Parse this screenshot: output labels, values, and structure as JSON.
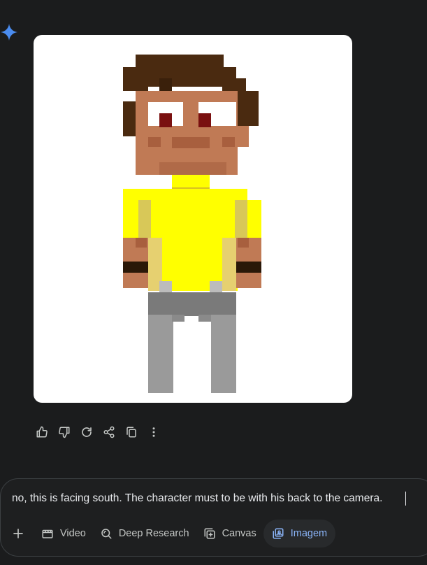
{
  "response": {
    "image_alt": "Pixel-art character with brown hair wearing a yellow t-shirt and gray pants, facing the camera",
    "actions": [
      {
        "name": "thumbs-up-icon"
      },
      {
        "name": "thumbs-down-icon"
      },
      {
        "name": "regenerate-icon"
      },
      {
        "name": "share-icon"
      },
      {
        "name": "copy-icon"
      },
      {
        "name": "more-options-icon"
      }
    ]
  },
  "composer": {
    "input_value": "no, this is facing south. The character must to be with his back to the camera.",
    "tools": {
      "add_icon": "plus-icon",
      "video_label": "Video",
      "deep_research_label": "Deep Research",
      "canvas_label": "Canvas",
      "image_label": "Imagem"
    },
    "active_tool": "Imagem"
  },
  "colors": {
    "background": "#1b1c1d",
    "accent": "#8ab4f8",
    "gem_star": "#4a8cf0",
    "shirt": "#ffff00",
    "skin": "#c07a55",
    "hair": "#4a2a10",
    "pants": "#9a9a9a"
  }
}
